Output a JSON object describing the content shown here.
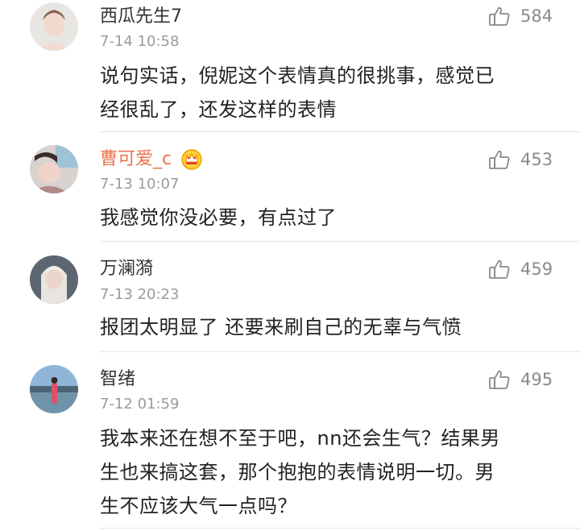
{
  "comments": [
    {
      "username": "西瓜先生7",
      "time": "7-14 10:58",
      "likes": "584",
      "text_lines": [
        "说句实话，倪妮这个表情真的很挑事，感觉已",
        "经很乱了，还发这样的表情"
      ]
    },
    {
      "username": "曹可爱_c",
      "time": "7-13 10:07",
      "likes": "453",
      "text_lines": [
        "我感觉你没必要，有点过了"
      ]
    },
    {
      "username": "万澜漪",
      "time": "7-13 20:23",
      "likes": "459",
      "text_lines": [
        "报团太明显了 还要来刷自己的无辜与气愤"
      ]
    },
    {
      "username": "智绪",
      "time": "7-12 01:59",
      "likes": "495",
      "text_lines": [
        "我本来还在想不至于吧，nn还会生气？结果男",
        "生也来搞这套，那个抱抱的表情说明一切。男",
        "生不应该大气一点吗？"
      ]
    }
  ],
  "colors": {
    "vip_name": "#eb7350",
    "meta": "#9b9b9b",
    "divider": "#e6e6e6"
  }
}
